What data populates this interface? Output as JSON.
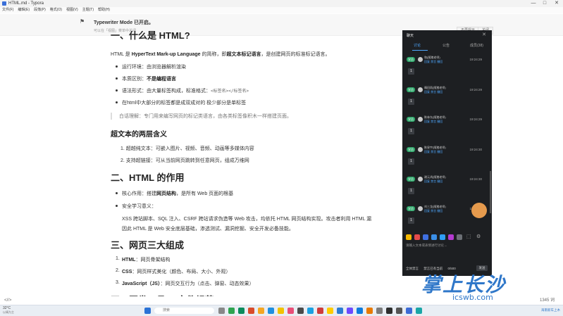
{
  "window": {
    "title": "HTML.md - Typora",
    "min": "—",
    "max": "□",
    "close": "✕"
  },
  "menu": [
    "文件(F)",
    "编辑(E)",
    "段落(P)",
    "格式(O)",
    "视图(V)",
    "主题(T)",
    "帮助(H)"
  ],
  "notify": {
    "title": "Typewriter Mode 已开启。",
    "subtitle": "可以在「视图」菜单中关闭",
    "btn1": "不再提示",
    "btn2": "关闭"
  },
  "doc": {
    "h_top": "一、什么是 HTML?",
    "intro_pre": "HTML 是 ",
    "intro_bold": "HyperText Mark-up Language",
    "intro_mid": " 的简称，即",
    "intro_bold2": "超文本标记语言",
    "intro_post": "，是创建网页的标准标记语言。",
    "list1": [
      {
        "pre": "运行环境：由浏览器解析渲染",
        "bold": ""
      },
      {
        "pre": "本质区别：",
        "bold": "不是编程语言"
      },
      {
        "pre": "语法形式：由大量标签构成，标准格式：",
        "code": "<标签名></标签名>"
      },
      {
        "pre": "在html中大部分的标签都是成双成对的 极少部分是单标签",
        "bold": ""
      }
    ],
    "quote": "白话理解：专门用来编写网页的标记类语言，由各类标签像积木一样搭建页面。",
    "h3": "超文本的两层含义",
    "list2": [
      "1. 超越纯文本：可嵌入图片、视频、音频、动画等多媒体内容",
      "2. 支持超链接：可从当前网页跳转到任意网页，组成万维网"
    ],
    "h2b": "二、HTML 的作用",
    "list3_a_pre": "核心作用：搭建",
    "list3_a_bold": "网页结构",
    "list3_a_post": "，是所有 Web 页面的根基",
    "list3_b": "安全学习意义：",
    "sec1": "XSS 跨站脚本、SQL 注入、CSRF 跨站请求伪造等 Web 攻击，均依托 HTML 网页结构实现。攻击者利用 HTML 漏",
    "sec2": "因此 HTML 是 Web 安全底层基础，渗透测试、漏洞挖掘、安全开发必备技能。",
    "h2c": "三、网页三大组成",
    "list4": [
      {
        "n": "1.",
        "bold": "HTML",
        "rest": "：网页骨架结构"
      },
      {
        "n": "2.",
        "bold": "CSS",
        "rest": "：网页样式美化（颜色、布局、大小、外观）"
      },
      {
        "n": "3.",
        "bold": "JavaScript（JS）",
        "rest": "：网页交互行为（点击、弹窗、动态效果）"
      }
    ],
    "h2d": "四、开发工具 & 文件规范"
  },
  "status": {
    "left": "<//>",
    "words": "1345 词"
  },
  "chat": {
    "title": "聊天",
    "tabs": [
      "讨论",
      "公告",
      "成员(38)"
    ],
    "messages": [
      {
        "badge": "学员",
        "name": "和(随猪老师)",
        "actions": "回复  禁言  撤回",
        "time": "19:24:29",
        "text": "1"
      },
      {
        "badge": "学员",
        "name": "晴田雨(随猪老师)",
        "actions": "回复  禁言  撤回",
        "time": "19:24:29",
        "text": "1"
      },
      {
        "badge": "学员",
        "name": "陈林东(随猪老师)",
        "actions": "回复  禁言  撤回",
        "time": "19:24:29",
        "text": "1"
      },
      {
        "badge": "学员",
        "name": "陈泉宇(随猪老师)",
        "actions": "回复  禁言  撤回",
        "time": "19:24:30",
        "text": "1"
      },
      {
        "badge": "学员",
        "name": "谢元鸿(随猪老师)",
        "actions": "回复  禁言  撤回",
        "time": "19:24:30",
        "text": "1"
      },
      {
        "badge": "学员",
        "name": "刘三龙(随猪老师)",
        "actions": "回复  禁言  撤回",
        "time": "19:24:31",
        "text": "1"
      }
    ],
    "input_placeholder": "请输入文本或表情进行讨论→",
    "footer_left": "全体禁言",
    "footer_mid": "禁言已有当前",
    "counter": "0/500",
    "send": "发送"
  },
  "taskbar": {
    "weather": "32°C",
    "weather_sub": "以晴为主",
    "search": "搜索"
  },
  "watermark": {
    "big": "掌上长沙",
    "url": "icswb.com",
    "small": "海南新车上木"
  }
}
